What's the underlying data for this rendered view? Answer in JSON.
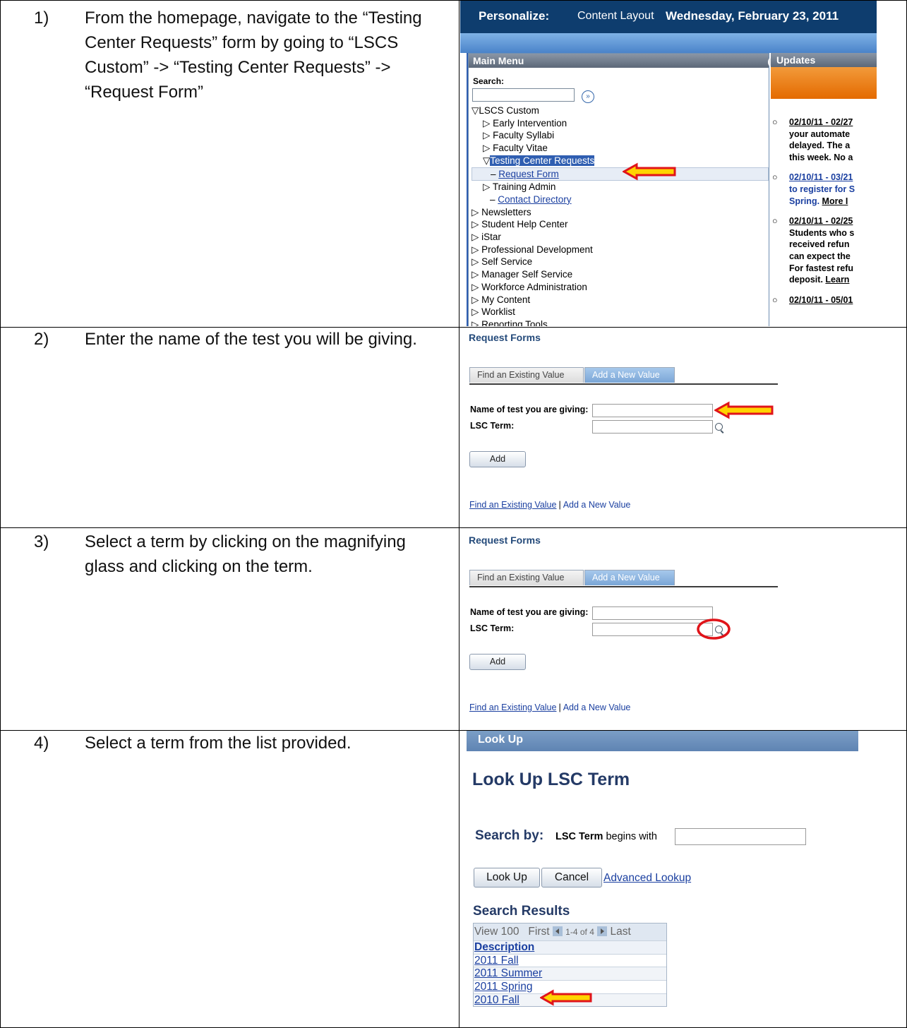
{
  "steps": [
    {
      "num": "1)",
      "text": "From the homepage, navigate to the “Testing Center Requests” form by going to “LSCS Custom” -> “Testing Center Requests” -> “Request Form”"
    },
    {
      "num": "2)",
      "text": "Enter the name of the test you will be giving."
    },
    {
      "num": "3)",
      "text": "Select a term by clicking on the magnifying glass and clicking on the term."
    },
    {
      "num": "4)",
      "text": "Select a term from the list provided."
    }
  ],
  "portal": {
    "personalize": "Personalize:",
    "content_layout": "Content Layout",
    "date": "Wednesday, February 23, 2011",
    "main_menu_title": "Main Menu",
    "search_label": "Search:",
    "search_value": "",
    "go_icon": "double-chevron-right-icon",
    "menu": [
      "▽LSCS Custom",
      "▷ Early Intervention",
      "▷ Faculty Syllabi",
      "▷ Faculty Vitae",
      "Testing Center Requests",
      "Request Form",
      "▷ Training Admin",
      "Contact Directory",
      "▷ Newsletters",
      "▷ Student Help Center",
      "▷ iStar",
      "▷ Professional Development",
      "▷ Self Service",
      "▷ Manager Self Service",
      "▷ Workforce Administration",
      "▷ My Content",
      "▷ Worklist",
      "▷ Reporting Tools"
    ],
    "updates_title": "Updates",
    "updates": [
      {
        "date": "02/10/11 - 02/27",
        "lines": [
          "your automate",
          "delayed. The a",
          "this week. No a"
        ]
      },
      {
        "date": "02/10/11 - 03/21",
        "lines": [
          "to register for S",
          "Spring."
        ],
        "more": "More I"
      },
      {
        "date": "02/10/11 - 02/25",
        "lines": [
          "Students who s",
          "received refun",
          "can expect the",
          "For fastest refu",
          "deposit."
        ],
        "more": "Learn"
      },
      {
        "date": "02/10/11 - 05/01",
        "lines": []
      }
    ]
  },
  "request_forms": {
    "title": "Request Forms",
    "tab_find": "Find an Existing Value",
    "tab_add": "Add a New Value",
    "name_label": "Name of test you are giving:",
    "term_label": "LSC Term:",
    "name_value": "",
    "term_value": "",
    "add_button": "Add",
    "link_find": "Find an Existing Value",
    "link_add": "Add a New Value"
  },
  "lookup": {
    "header": "Look Up",
    "title": "Look Up LSC Term",
    "search_by": "Search by:",
    "field": "LSC Term",
    "operator": "begins with",
    "search_value": "",
    "lookup_button": "Look Up",
    "cancel_button": "Cancel",
    "advanced_link": "Advanced Lookup",
    "results_title": "Search Results",
    "nav_view": "View 100",
    "nav_first": "First",
    "nav_range": "1-4 of 4",
    "nav_last": "Last",
    "column": "Description",
    "rows": [
      "2011 Fall",
      "2011 Summer",
      "2011 Spring",
      "2010 Fall"
    ]
  },
  "colors": {
    "arrow_red": "#e0141a",
    "arrow_yellow": "#ffd400",
    "portal_blue": "#0e3d6e",
    "link_blue": "#1a3fa0"
  }
}
